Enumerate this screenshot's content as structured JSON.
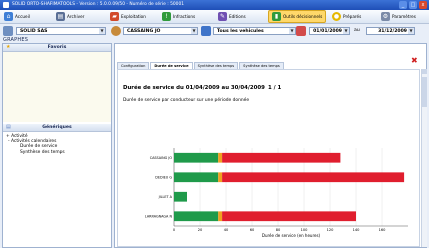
{
  "titlebar": {
    "title": "SOLID ORTO-SHAFIMATOOLS - Version : 5.0.0.09/50 - Numéro de série : 50001",
    "min": "_",
    "max": "□",
    "close": "x"
  },
  "toolbar": {
    "items": [
      {
        "label": "Accueil",
        "icon": "home-icon",
        "color": "#3f7fd6"
      },
      {
        "label": "Archiver",
        "icon": "archive-icon",
        "color": "#5a6f96"
      },
      {
        "label": "Exploitation",
        "icon": "truck-icon",
        "color": "#d24a2a"
      },
      {
        "label": "Infractions",
        "icon": "infraction-icon",
        "color": "#2f9a3c"
      },
      {
        "label": "Editions",
        "icon": "editions-icon",
        "color": "#6f4fb2"
      },
      {
        "label": "Outils décisionnels",
        "icon": "chart-tools-icon",
        "color": "#2f9a3c"
      },
      {
        "label": "Préparés",
        "icon": "prepared-icon",
        "color": "#e6b800"
      },
      {
        "label": "Paramètres",
        "icon": "settings-icon",
        "color": "#7a8aa8"
      }
    ]
  },
  "selectors": {
    "company": "SOLID SAS",
    "driver": "CASSAING JO",
    "vehicles": "Tous les vehicules",
    "date_from": "01/01/2009",
    "date_sep": "au",
    "date_to": "31/12/2009"
  },
  "section_label": "GRAPHES",
  "left_panel": {
    "favorites_title": "Favoris",
    "generic_title": "Génériques",
    "tree": [
      "+ Activité",
      "- Activités calendaires",
      "Durée de service",
      "Synthèse des temps"
    ]
  },
  "tabs": [
    "Configuration",
    "Durée de service",
    "Synthèse des temps",
    "Synthèse des temps"
  ],
  "active_tab": 1,
  "report": {
    "title": "Durée de service du 01/04/2009 au 30/04/2009",
    "page": "1 / 1",
    "subtitle": "Durée de service par conducteur sur une période donnée"
  },
  "chart_data": {
    "type": "bar",
    "orientation": "horizontal",
    "stacked": true,
    "categories": [
      "CASSAING JO",
      "DEDIEU G",
      "JILLET A",
      "LARRAGNAGA N"
    ],
    "series": [
      {
        "color": "#1f9a4a",
        "values": [
          34,
          34,
          10,
          34
        ]
      },
      {
        "color": "#f0a020",
        "values": [
          3,
          3,
          0,
          3
        ]
      },
      {
        "color": "#e01e2e",
        "values": [
          91,
          140,
          0,
          103
        ]
      }
    ],
    "xlabel": "Durée de service (en heures)",
    "xlim": [
      0,
      180
    ],
    "xticks": [
      "0",
      "20",
      "40",
      "60",
      "80",
      "100",
      "120",
      "140",
      "160"
    ],
    "grid": true
  }
}
